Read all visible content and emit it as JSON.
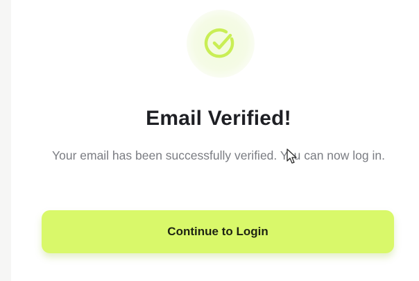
{
  "dialog": {
    "icon": "check-circle-icon",
    "title": "Email Verified!",
    "message": "Your email has been successfully verified. You can now log in.",
    "button_label": "Continue to Login"
  },
  "colors": {
    "accent": "#d9f86a",
    "icon_stroke": "#c9ee55",
    "title": "#1e1f24",
    "message": "#7a7c82"
  },
  "cursor": {
    "icon": "arrow-cursor-icon"
  }
}
